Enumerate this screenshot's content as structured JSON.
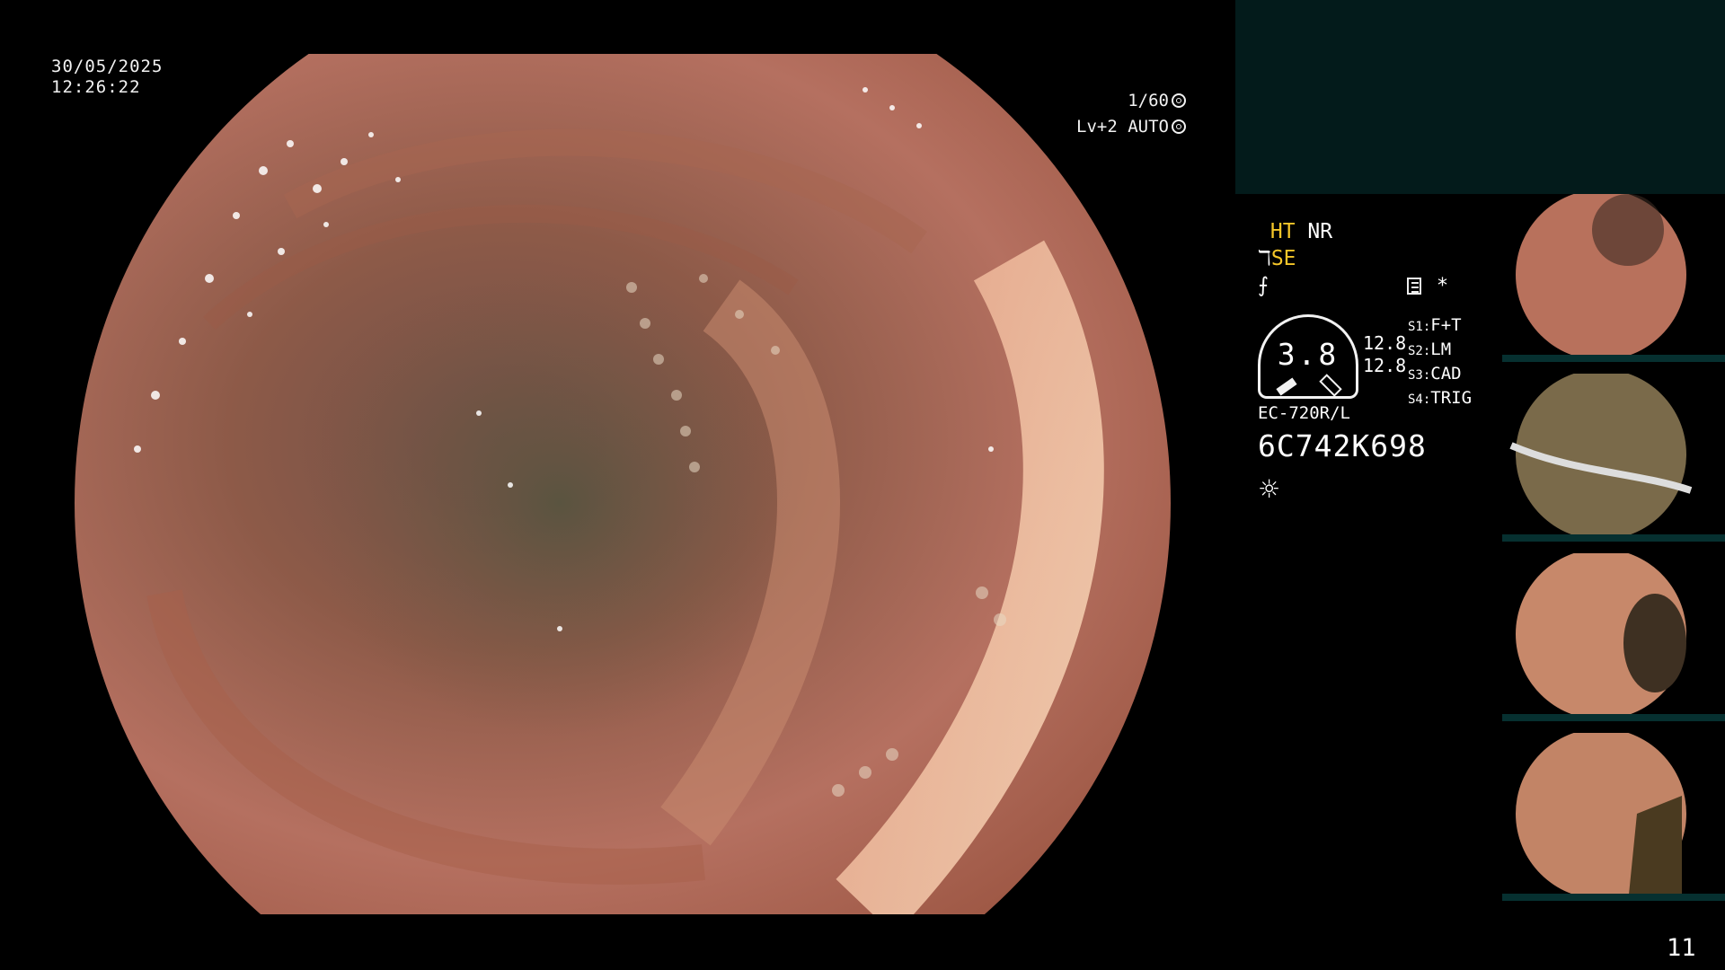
{
  "overlay": {
    "date": "30/05/2025",
    "time": "12:26:22",
    "shutter": "1/60",
    "level": "Lv+2",
    "exposure_mode": "AUTO"
  },
  "modes": {
    "ht": "HT",
    "nr": "NR",
    "se": "SE",
    "se_prefix": "ℸ",
    "f_symbol": "⨍",
    "star": "*"
  },
  "gauge": {
    "value": "3.8",
    "top": "12.8",
    "bottom": "12.8"
  },
  "scope_settings": [
    {
      "key": "S1:",
      "value": "F+T"
    },
    {
      "key": "S2:",
      "value": "LM"
    },
    {
      "key": "S3:",
      "value": "CAD"
    },
    {
      "key": "S4:",
      "value": "TRIG"
    }
  ],
  "device": {
    "model": "EC-720R/L",
    "serial": "6C742K698",
    "lamp_icon": "☼"
  },
  "thumbnails": [
    {
      "name": "thumbnail-1",
      "tint": "#b8715c"
    },
    {
      "name": "thumbnail-2",
      "tint": "#7a6a4a"
    },
    {
      "name": "thumbnail-3",
      "tint": "#c7886a"
    },
    {
      "name": "thumbnail-4",
      "tint": "#c28466"
    }
  ],
  "page_number": "11",
  "colors": {
    "teal_panel": "#031b1b",
    "accent_yellow": "#f5c629",
    "thumb_bar": "#063030"
  }
}
